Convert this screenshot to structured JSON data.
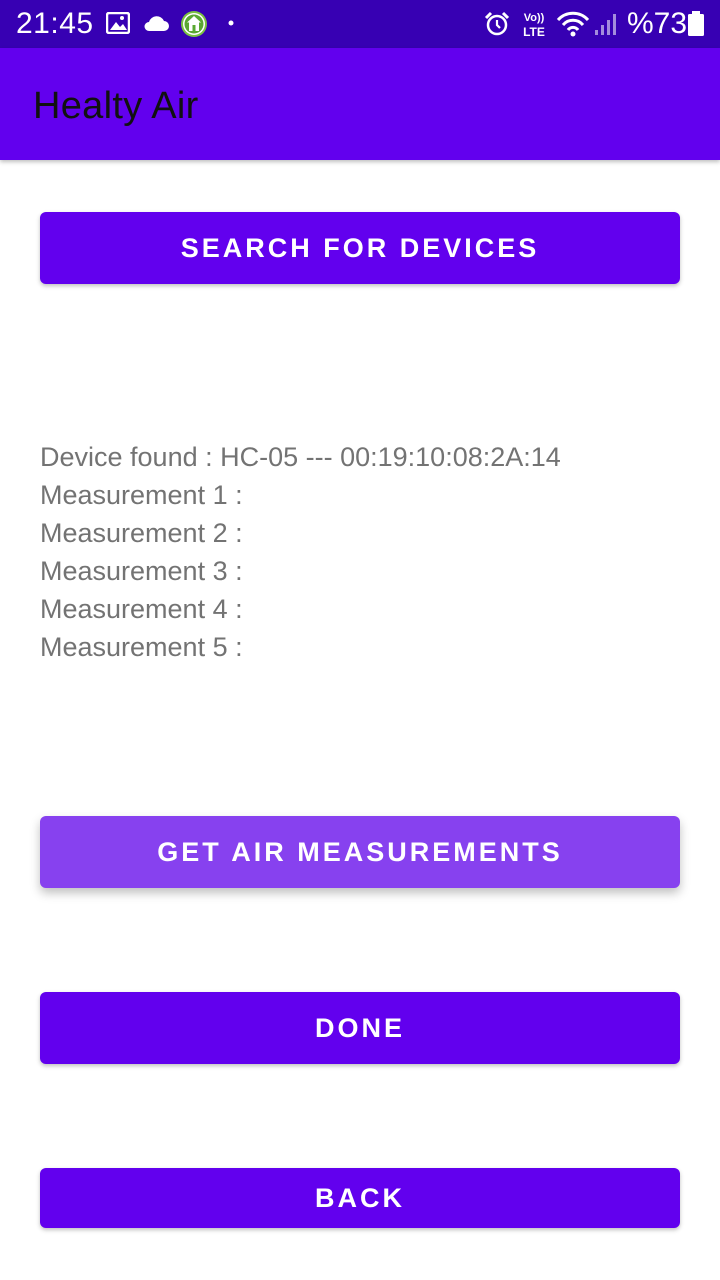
{
  "status_bar": {
    "time": "21:45",
    "battery": "%73",
    "icons": [
      "gallery-icon",
      "cloud-icon",
      "home-app-icon",
      "dot-icon",
      "alarm-icon",
      "volte-icon",
      "wifi-icon",
      "signal-icon",
      "battery-icon"
    ],
    "volte_top": "Vo))",
    "volte_bottom": "LTE"
  },
  "app_bar": {
    "title": "Healty Air"
  },
  "buttons": {
    "search": "SEARCH FOR DEVICES",
    "get_measurements": "GET AIR MEASUREMENTS",
    "done": "DONE",
    "back": "BACK"
  },
  "info": {
    "device_found": "Device found : HC-05 --- 00:19:10:08:2A:14",
    "measurements": [
      "Measurement 1 :",
      "Measurement 2 :",
      "Measurement 3 :",
      "Measurement 4 :",
      "Measurement 5 :"
    ]
  },
  "colors": {
    "status_bar": "#3700b3",
    "primary": "#6200ee",
    "primary_light": "#8741ef",
    "info_text": "#737373"
  }
}
